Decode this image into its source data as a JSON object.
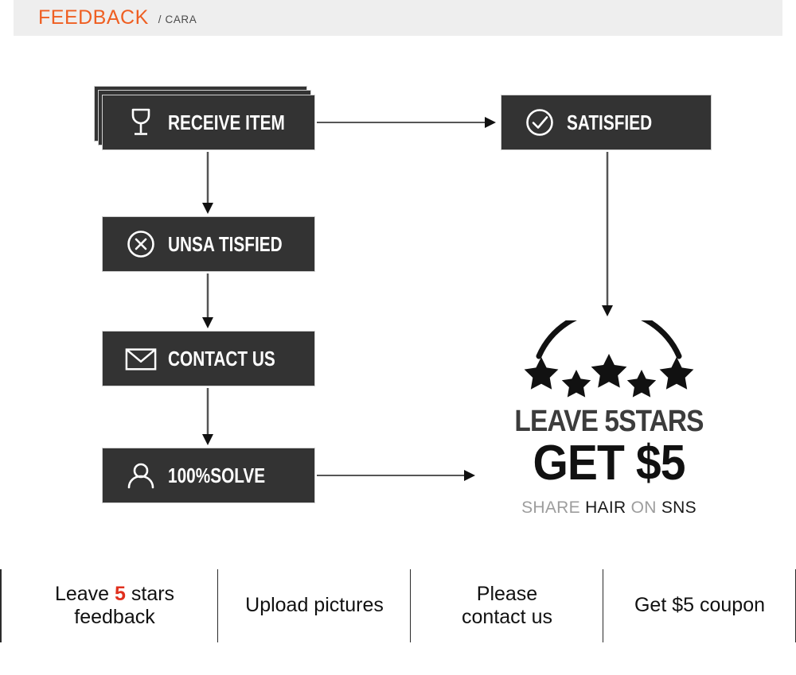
{
  "header": {
    "title": "FEEDBACK",
    "subtitle": "/ CARA",
    "accent_color": "#ef5f22",
    "band_color": "#eeeeee"
  },
  "flow": {
    "box_fill": "#333333",
    "box_border": "#cfcfcf",
    "label_color": "#ffffff",
    "boxes": [
      {
        "id": "receive-item",
        "label": "RECEIVE ITEM",
        "icon": "wine-glass-icon",
        "stacked": true
      },
      {
        "id": "unsatisfied",
        "label": "UNSA TISFIED",
        "icon": "circle-x-icon",
        "stacked": false
      },
      {
        "id": "contact-us",
        "label": "CONTACT US",
        "icon": "envelope-icon",
        "stacked": false
      },
      {
        "id": "solve",
        "label": "100%SOLVE",
        "icon": "person-icon",
        "stacked": false
      },
      {
        "id": "satisfied",
        "label": "SATISFIED",
        "icon": "circle-check-icon",
        "stacked": false
      }
    ],
    "connectors": [
      {
        "from": "receive-item",
        "to": "satisfied",
        "direction": "right"
      },
      {
        "from": "receive-item",
        "to": "unsatisfied",
        "direction": "down"
      },
      {
        "from": "unsatisfied",
        "to": "contact-us",
        "direction": "down"
      },
      {
        "from": "contact-us",
        "to": "solve",
        "direction": "down"
      },
      {
        "from": "satisfied",
        "to": "stars",
        "direction": "down"
      },
      {
        "from": "solve",
        "to": "stars",
        "direction": "right"
      }
    ]
  },
  "coupon": {
    "stars_count": 5,
    "headline": "LEAVE 5STARS",
    "subheadline": "GET $5",
    "share_parts": [
      {
        "text": "SHARE",
        "emphasis": false
      },
      {
        "text": "HAIR",
        "emphasis": true
      },
      {
        "text": "ON",
        "emphasis": false
      },
      {
        "text": "SNS",
        "emphasis": true
      }
    ]
  },
  "benefits": [
    {
      "id": "leave-5-stars-feedback",
      "line1_pre": "Leave ",
      "accent": "5",
      "line1_post": " stars",
      "line2": "feedback"
    },
    {
      "id": "upload-pictures",
      "line1_pre": "Upload pictures",
      "accent": "",
      "line1_post": "",
      "line2": ""
    },
    {
      "id": "please-contact-us",
      "line1_pre": "Please",
      "accent": "",
      "line1_post": "",
      "line2": "contact us"
    },
    {
      "id": "get-5-coupon",
      "line1_pre": "Get $5 coupon",
      "accent": "",
      "line1_post": "",
      "line2": ""
    }
  ]
}
